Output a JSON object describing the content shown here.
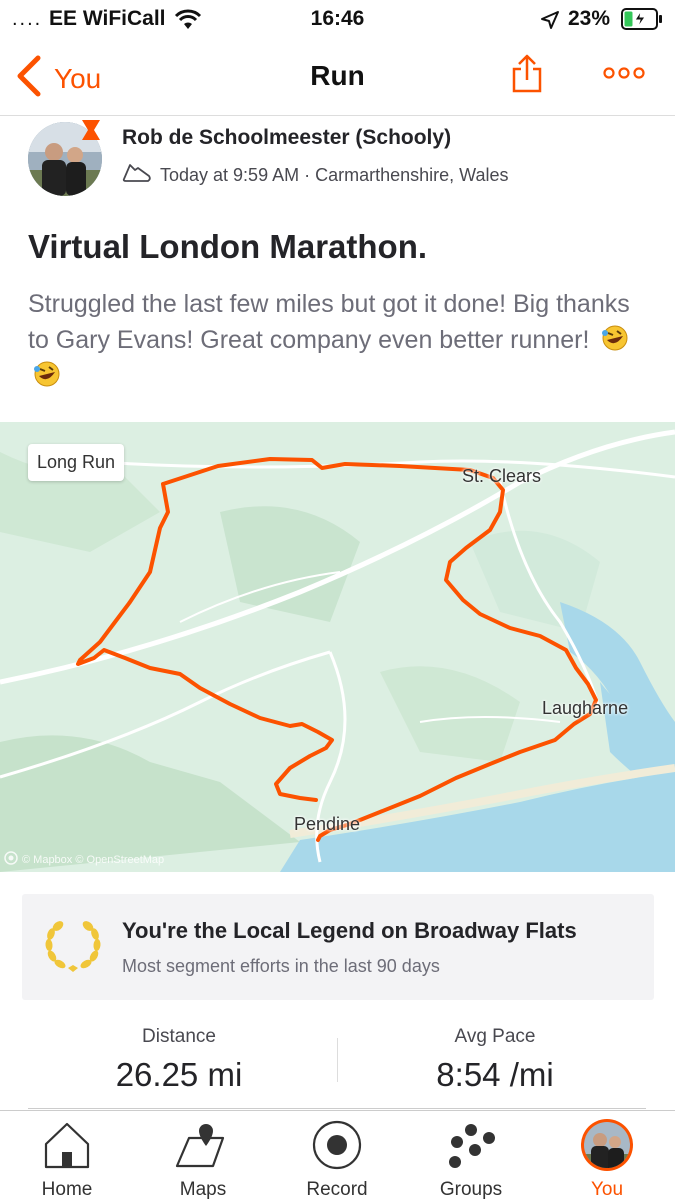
{
  "status_bar": {
    "signal": "....",
    "carrier": "EE WiFiCall",
    "time": "16:46",
    "battery": "23%"
  },
  "nav": {
    "back_label": "You",
    "title": "Run"
  },
  "activity": {
    "athlete_name": "Rob de Schoolmeester (Schooly)",
    "meta": "Today at 9:59 AM · Carmarthenshire, Wales",
    "title": "Virtual London Marathon.",
    "description": "Struggled the last few miles but got it done! Big thanks to Gary Evans! Great company even better runner!"
  },
  "map": {
    "tag": "Long Run",
    "places": {
      "st_clears": "St. Clears",
      "laugharne": "Laugharne",
      "pendine": "Pendine"
    },
    "credit": "© Mapbox © OpenStreetMap",
    "route_color": "#fc5200"
  },
  "legend": {
    "title": "You're the Local Legend on Broadway Flats",
    "subtitle": "Most segment efforts in the last 90 days"
  },
  "stats": {
    "distance_label": "Distance",
    "distance_value": "26.25 mi",
    "pace_label": "Avg Pace",
    "pace_value": "8:54 /mi"
  },
  "tabs": [
    {
      "label": "Home",
      "icon": "home-icon"
    },
    {
      "label": "Maps",
      "icon": "map-icon"
    },
    {
      "label": "Record",
      "icon": "record-icon"
    },
    {
      "label": "Groups",
      "icon": "groups-icon"
    },
    {
      "label": "You",
      "icon": "avatar",
      "active": true
    }
  ],
  "colors": {
    "accent": "#fc5200",
    "text": "#242428",
    "muted": "#6d6d78"
  }
}
